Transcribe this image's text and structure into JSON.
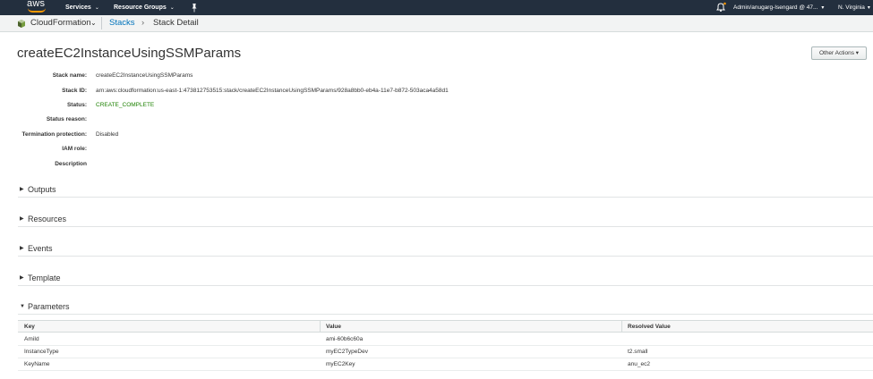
{
  "nav": {
    "logo_text": "aws",
    "services": "Services",
    "resource_groups": "Resource Groups",
    "account": "Admin/anugarg-Isengard @ 47...",
    "region": "N. Virginia"
  },
  "servicebar": {
    "service": "CloudFormation",
    "breadcrumb_link": "Stacks",
    "breadcrumb_sep": "›",
    "breadcrumb_current": "Stack Detail"
  },
  "page": {
    "title": "createEC2InstanceUsingSSMParams",
    "other_actions": "Other Actions ▾"
  },
  "details": [
    {
      "label": "Stack name:",
      "value": "createEC2InstanceUsingSSMParams"
    },
    {
      "label": "Stack ID:",
      "value": "arn:aws:cloudformation:us-east-1:473812753515:stack/createEC2InstanceUsingSSMParams/928a8bb0-eb4a-11e7-b872-503aca4a58d1"
    },
    {
      "label": "Status:",
      "value": "CREATE_COMPLETE"
    },
    {
      "label": "Status reason:",
      "value": ""
    },
    {
      "label": "Termination protection:",
      "value": "Disabled"
    },
    {
      "label": "IAM role:",
      "value": ""
    },
    {
      "label": "Description",
      "value": ""
    }
  ],
  "sections": [
    {
      "label": "Outputs",
      "expanded": false
    },
    {
      "label": "Resources",
      "expanded": false
    },
    {
      "label": "Events",
      "expanded": false
    },
    {
      "label": "Template",
      "expanded": false
    },
    {
      "label": "Parameters",
      "expanded": true
    }
  ],
  "parameters": {
    "columns": [
      "Key",
      "Value",
      "Resolved Value"
    ],
    "rows": [
      [
        "AmiId",
        "ami-60b6c60a",
        ""
      ],
      [
        "InstanceType",
        "myEC2TypeDev",
        "t2.small"
      ],
      [
        "KeyName",
        "myEC2Key",
        "anu_ec2"
      ]
    ]
  },
  "colors": {
    "nav_bg": "#232f3e",
    "accent": "#ff9900",
    "link": "#0073bb",
    "status_ok": "#1d8102"
  }
}
